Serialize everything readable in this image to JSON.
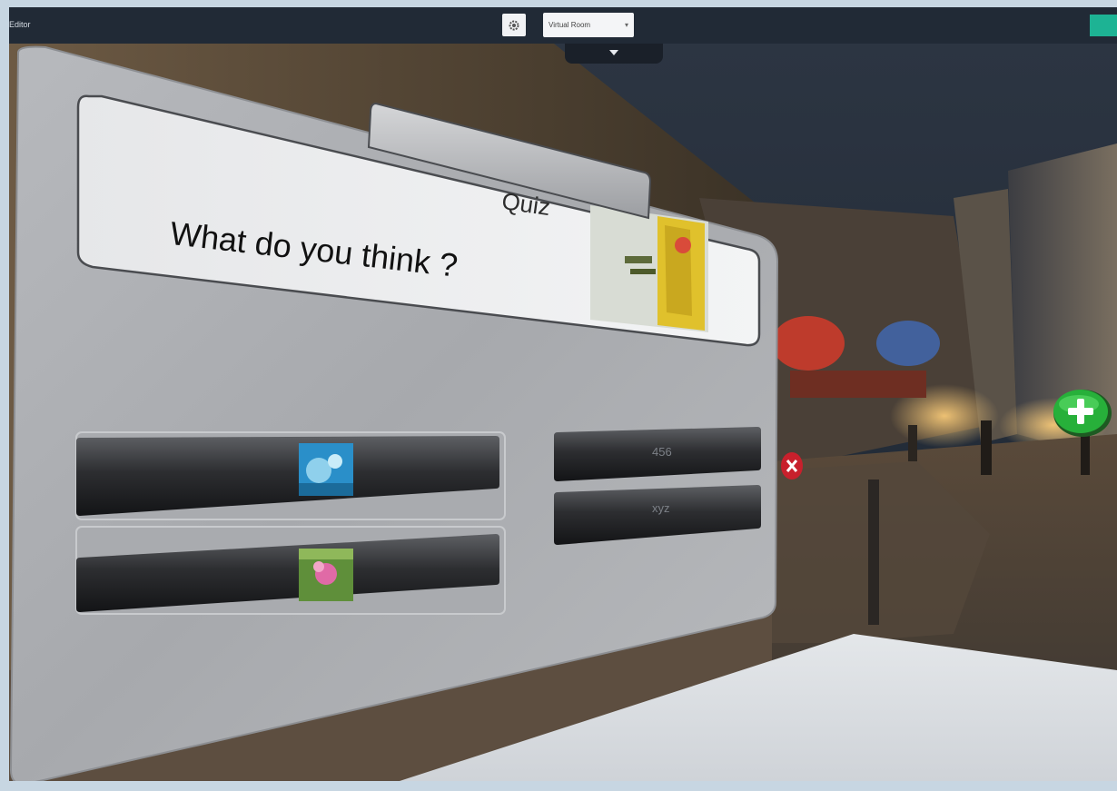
{
  "app": {
    "title": "Editor"
  },
  "toolbar": {
    "settings_icon": "gear-icon",
    "room_select": {
      "selected": "Virtual Room"
    },
    "drawer_icon": "caret-down-icon",
    "action_color": "#1db394"
  },
  "quiz": {
    "tab_label": "Quiz",
    "question": "What do you think ?",
    "answers_left": [
      {
        "kind": "image",
        "desc_icon": "image-thumbnail-blue"
      },
      {
        "kind": "image",
        "desc_icon": "image-thumbnail-flower"
      }
    ],
    "answers_right": [
      {
        "label": "456"
      },
      {
        "label": "xyz"
      }
    ]
  },
  "hotspots": {
    "add_icon": "plus-icon",
    "close_icon": "close-icon"
  }
}
